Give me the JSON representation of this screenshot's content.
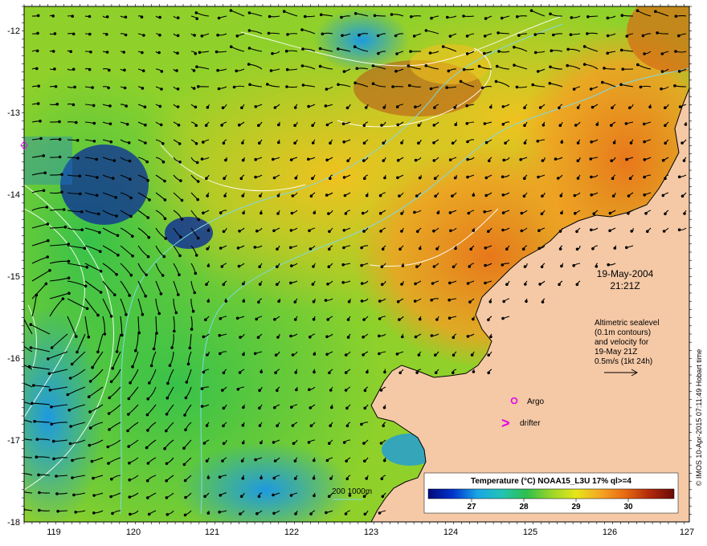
{
  "map": {
    "lon_ticks": [
      "119",
      "120",
      "121",
      "122",
      "123",
      "124",
      "125",
      "126",
      "127"
    ],
    "lat_ticks": [
      "-12",
      "-13",
      "-14",
      "-15",
      "-16",
      "-17",
      "-18"
    ],
    "lon_range": [
      118.6,
      127.0
    ],
    "lat_range": [
      -18.0,
      -11.7
    ]
  },
  "annotations": {
    "date": "19-May-2004",
    "time": "21:21Z",
    "altimetry_lines": [
      "Altimetric sealevel",
      "(0.1m contours)",
      "and velocity for",
      "19-May 21Z",
      "0.5m/s (1kt 24h)"
    ],
    "argo_label": "Argo",
    "drifter_label": "drifter",
    "drifter_symbol": ">",
    "depth_label": "200  1000m"
  },
  "colorbar": {
    "title": "Temperature (°C) NOAA15_L3U 17% ql>=4",
    "tick_labels": [
      "27",
      "28",
      "29",
      "30"
    ],
    "stops": [
      "#000a7a",
      "#0033cc",
      "#1aa6e6",
      "#22c3b4",
      "#2dbf4d",
      "#9ad62a",
      "#e6e619",
      "#f5a623",
      "#e86a12",
      "#b02a0c",
      "#6b0a05"
    ]
  },
  "credit": "© IMOS 10-Apr-2015 07:11:49 Hobart time",
  "colors": {
    "land": "#f5c9a6",
    "argo": "#e600e6",
    "drifter": "#e600e6",
    "contour": "#ffffff",
    "bathy": "#7fd9e6"
  }
}
